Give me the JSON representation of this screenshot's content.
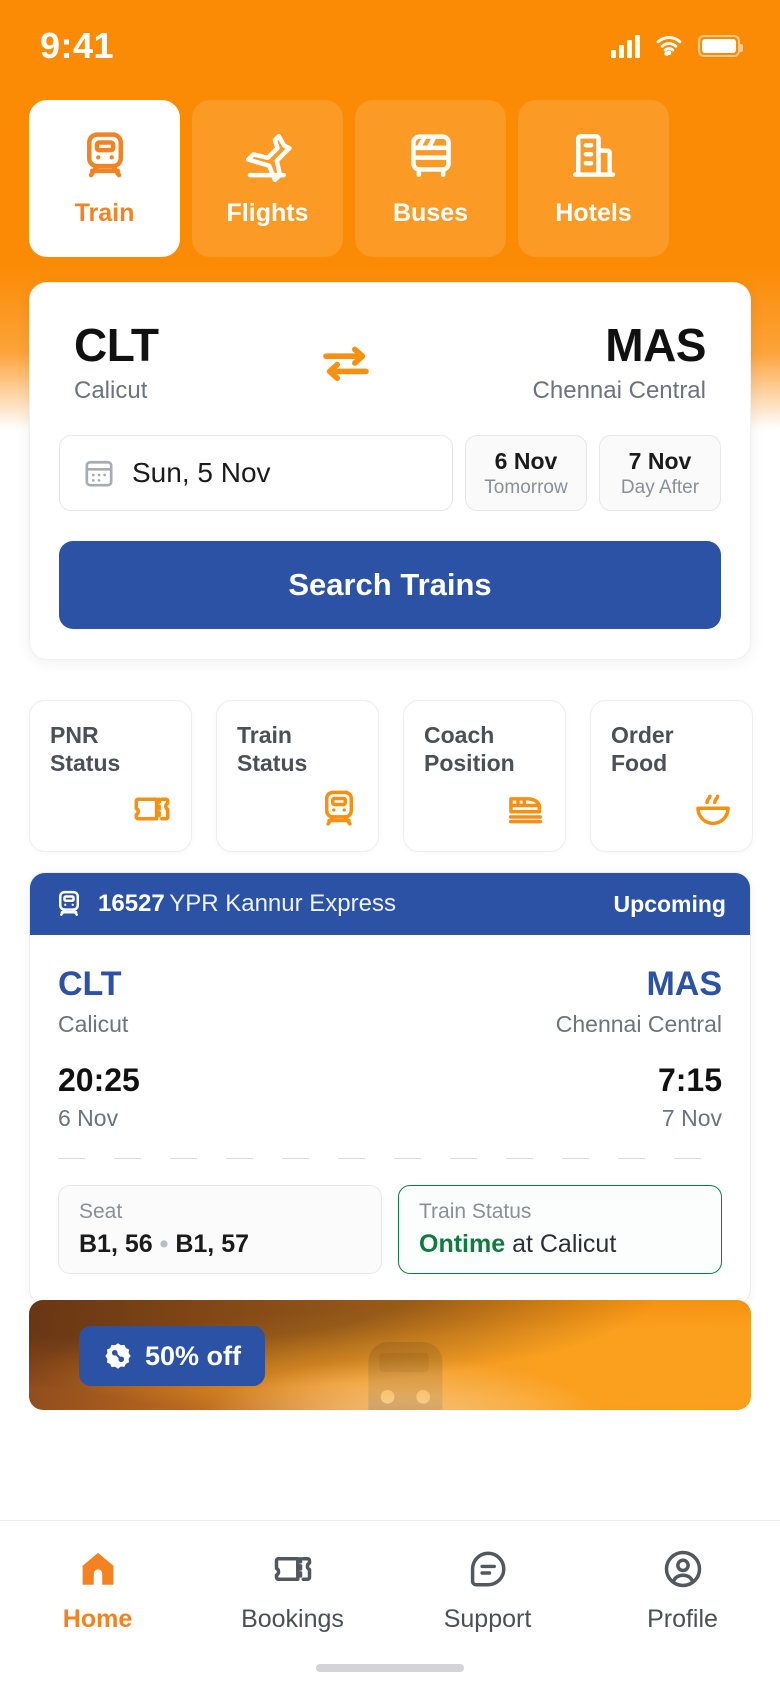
{
  "status_bar": {
    "time": "9:41",
    "signal_icon": "signal-bars-icon",
    "wifi_icon": "wifi-icon",
    "battery_icon": "battery-icon"
  },
  "theme": {
    "brand_orange": "#fb8b05",
    "accent_orange": "#f58220",
    "primary_blue": "#2c52a5",
    "success_green": "#0f7b3f",
    "muted_text": "#6b7280"
  },
  "modes": [
    {
      "label": "Train",
      "icon": "train-icon",
      "active": true
    },
    {
      "label": "Flights",
      "icon": "flight-takeoff-icon",
      "active": false
    },
    {
      "label": "Buses",
      "icon": "bus-icon",
      "active": false
    },
    {
      "label": "Hotels",
      "icon": "hotel-building-icon",
      "active": false
    }
  ],
  "search": {
    "from_code": "CLT",
    "from_city": "Calicut",
    "to_code": "MAS",
    "to_city": "Chennai Central",
    "swap_icon": "swap-arrows-icon",
    "calendar_icon": "calendar-icon",
    "date_value": "Sun, 5 Nov",
    "quick_dates": [
      {
        "day": "6 Nov",
        "sub": "Tomorrow"
      },
      {
        "day": "7 Nov",
        "sub": "Day After"
      }
    ],
    "submit_label": "Search Trains"
  },
  "quick_actions": [
    {
      "label": "PNR\nStatus",
      "line1": "PNR",
      "line2": "Status",
      "icon": "ticket-icon"
    },
    {
      "label": "Train\nStatus",
      "line1": "Train",
      "line2": "Status",
      "icon": "train-front-icon"
    },
    {
      "label": "Coach\nPosition",
      "line1": "Coach",
      "line2": "Position",
      "icon": "coach-train-icon"
    },
    {
      "label": "Order\nFood",
      "line1": "Order",
      "line2": "Food",
      "icon": "food-bowl-icon"
    }
  ],
  "trip": {
    "train_icon": "train-icon",
    "train_number": "16527",
    "train_name": "YPR Kannur Express",
    "status_badge": "Upcoming",
    "from_code": "CLT",
    "from_city": "Calicut",
    "from_time": "20:25",
    "from_date": "6 Nov",
    "to_code": "MAS",
    "to_city": "Chennai Central",
    "to_time": "7:15",
    "to_date": "7 Nov",
    "seat_label": "Seat",
    "seat_value_1": "B1, 56",
    "seat_separator": "•",
    "seat_value_2": "B1, 57",
    "status_label": "Train Status",
    "status_state": "Ontime",
    "status_suffix": " at Calicut"
  },
  "promo": {
    "badge_icon": "discount-percent-icon",
    "badge_text": "50% off"
  },
  "bottom_nav": [
    {
      "label": "Home",
      "icon": "home-icon",
      "active": true
    },
    {
      "label": "Bookings",
      "icon": "ticket-icon",
      "active": false
    },
    {
      "label": "Support",
      "icon": "chat-help-icon",
      "active": false
    },
    {
      "label": "Profile",
      "icon": "user-circle-icon",
      "active": false
    }
  ]
}
